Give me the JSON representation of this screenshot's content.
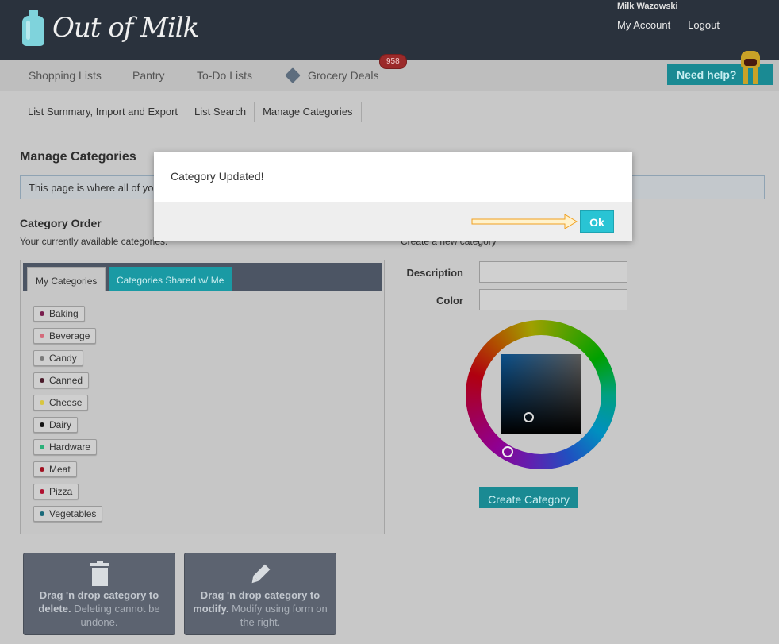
{
  "header": {
    "app_name": "Out of Milk",
    "user_name": "Milk Wazowski",
    "my_account": "My Account",
    "logout": "Logout"
  },
  "nav": {
    "shopping_lists": "Shopping Lists",
    "pantry": "Pantry",
    "todo_lists": "To-Do Lists",
    "grocery_deals": "Grocery Deals",
    "deals_badge": "958",
    "need_help": "Need help?"
  },
  "subnav": {
    "items": [
      "List Summary, Import and Export",
      "List Search",
      "Manage Categories"
    ]
  },
  "page": {
    "title": "Manage Categories",
    "info": "This page is where all of you",
    "order_title": "Category Order",
    "order_sub": "Your currently available categories.",
    "create_sub": "Create a new category"
  },
  "tabs": {
    "mine": "My Categories",
    "shared": "Categories Shared w/ Me"
  },
  "categories": [
    {
      "label": "Baking",
      "color": "#7a1e4e"
    },
    {
      "label": "Beverage",
      "color": "#d46a7a"
    },
    {
      "label": "Candy",
      "color": "#7a7a7a"
    },
    {
      "label": "Canned",
      "color": "#4a1a2a"
    },
    {
      "label": "Cheese",
      "color": "#d8c640"
    },
    {
      "label": "Dairy",
      "color": "#111111"
    },
    {
      "label": "Hardware",
      "color": "#2bb07a"
    },
    {
      "label": "Meat",
      "color": "#a01020"
    },
    {
      "label": "Pizza",
      "color": "#b01030"
    },
    {
      "label": "Vegetables",
      "color": "#1a6a7a"
    }
  ],
  "form": {
    "description_label": "Description",
    "color_label": "Color",
    "description_value": "",
    "color_value": "",
    "create_button": "Create Category"
  },
  "dropzones": {
    "delete_bold": "Drag 'n drop category to delete.",
    "delete_rest": " Deleting cannot be undone.",
    "modify_bold": "Drag 'n drop category to modify.",
    "modify_rest": " Modify using form on the right."
  },
  "modal": {
    "message": "Category Updated!",
    "ok": "Ok"
  },
  "colors": {
    "header_bg": "#2a323d",
    "accent": "#1a8a93",
    "ok_button": "#29c4d4"
  }
}
